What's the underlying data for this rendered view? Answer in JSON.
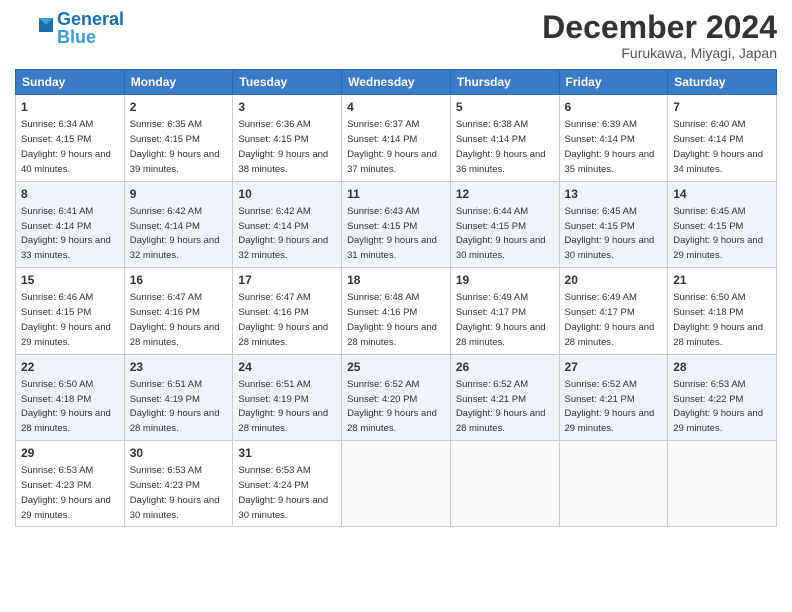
{
  "header": {
    "logo_line1": "General",
    "logo_line2": "Blue",
    "month": "December 2024",
    "location": "Furukawa, Miyagi, Japan"
  },
  "days_of_week": [
    "Sunday",
    "Monday",
    "Tuesday",
    "Wednesday",
    "Thursday",
    "Friday",
    "Saturday"
  ],
  "weeks": [
    [
      {
        "day": "1",
        "sunrise": "6:34 AM",
        "sunset": "4:15 PM",
        "daylight": "9 hours and 40 minutes."
      },
      {
        "day": "2",
        "sunrise": "6:35 AM",
        "sunset": "4:15 PM",
        "daylight": "9 hours and 39 minutes."
      },
      {
        "day": "3",
        "sunrise": "6:36 AM",
        "sunset": "4:15 PM",
        "daylight": "9 hours and 38 minutes."
      },
      {
        "day": "4",
        "sunrise": "6:37 AM",
        "sunset": "4:14 PM",
        "daylight": "9 hours and 37 minutes."
      },
      {
        "day": "5",
        "sunrise": "6:38 AM",
        "sunset": "4:14 PM",
        "daylight": "9 hours and 36 minutes."
      },
      {
        "day": "6",
        "sunrise": "6:39 AM",
        "sunset": "4:14 PM",
        "daylight": "9 hours and 35 minutes."
      },
      {
        "day": "7",
        "sunrise": "6:40 AM",
        "sunset": "4:14 PM",
        "daylight": "9 hours and 34 minutes."
      }
    ],
    [
      {
        "day": "8",
        "sunrise": "6:41 AM",
        "sunset": "4:14 PM",
        "daylight": "9 hours and 33 minutes."
      },
      {
        "day": "9",
        "sunrise": "6:42 AM",
        "sunset": "4:14 PM",
        "daylight": "9 hours and 32 minutes."
      },
      {
        "day": "10",
        "sunrise": "6:42 AM",
        "sunset": "4:14 PM",
        "daylight": "9 hours and 32 minutes."
      },
      {
        "day": "11",
        "sunrise": "6:43 AM",
        "sunset": "4:15 PM",
        "daylight": "9 hours and 31 minutes."
      },
      {
        "day": "12",
        "sunrise": "6:44 AM",
        "sunset": "4:15 PM",
        "daylight": "9 hours and 30 minutes."
      },
      {
        "day": "13",
        "sunrise": "6:45 AM",
        "sunset": "4:15 PM",
        "daylight": "9 hours and 30 minutes."
      },
      {
        "day": "14",
        "sunrise": "6:45 AM",
        "sunset": "4:15 PM",
        "daylight": "9 hours and 29 minutes."
      }
    ],
    [
      {
        "day": "15",
        "sunrise": "6:46 AM",
        "sunset": "4:15 PM",
        "daylight": "9 hours and 29 minutes."
      },
      {
        "day": "16",
        "sunrise": "6:47 AM",
        "sunset": "4:16 PM",
        "daylight": "9 hours and 28 minutes."
      },
      {
        "day": "17",
        "sunrise": "6:47 AM",
        "sunset": "4:16 PM",
        "daylight": "9 hours and 28 minutes."
      },
      {
        "day": "18",
        "sunrise": "6:48 AM",
        "sunset": "4:16 PM",
        "daylight": "9 hours and 28 minutes."
      },
      {
        "day": "19",
        "sunrise": "6:49 AM",
        "sunset": "4:17 PM",
        "daylight": "9 hours and 28 minutes."
      },
      {
        "day": "20",
        "sunrise": "6:49 AM",
        "sunset": "4:17 PM",
        "daylight": "9 hours and 28 minutes."
      },
      {
        "day": "21",
        "sunrise": "6:50 AM",
        "sunset": "4:18 PM",
        "daylight": "9 hours and 28 minutes."
      }
    ],
    [
      {
        "day": "22",
        "sunrise": "6:50 AM",
        "sunset": "4:18 PM",
        "daylight": "9 hours and 28 minutes."
      },
      {
        "day": "23",
        "sunrise": "6:51 AM",
        "sunset": "4:19 PM",
        "daylight": "9 hours and 28 minutes."
      },
      {
        "day": "24",
        "sunrise": "6:51 AM",
        "sunset": "4:19 PM",
        "daylight": "9 hours and 28 minutes."
      },
      {
        "day": "25",
        "sunrise": "6:52 AM",
        "sunset": "4:20 PM",
        "daylight": "9 hours and 28 minutes."
      },
      {
        "day": "26",
        "sunrise": "6:52 AM",
        "sunset": "4:21 PM",
        "daylight": "9 hours and 28 minutes."
      },
      {
        "day": "27",
        "sunrise": "6:52 AM",
        "sunset": "4:21 PM",
        "daylight": "9 hours and 29 minutes."
      },
      {
        "day": "28",
        "sunrise": "6:53 AM",
        "sunset": "4:22 PM",
        "daylight": "9 hours and 29 minutes."
      }
    ],
    [
      {
        "day": "29",
        "sunrise": "6:53 AM",
        "sunset": "4:23 PM",
        "daylight": "9 hours and 29 minutes."
      },
      {
        "day": "30",
        "sunrise": "6:53 AM",
        "sunset": "4:23 PM",
        "daylight": "9 hours and 30 minutes."
      },
      {
        "day": "31",
        "sunrise": "6:53 AM",
        "sunset": "4:24 PM",
        "daylight": "9 hours and 30 minutes."
      },
      null,
      null,
      null,
      null
    ]
  ]
}
